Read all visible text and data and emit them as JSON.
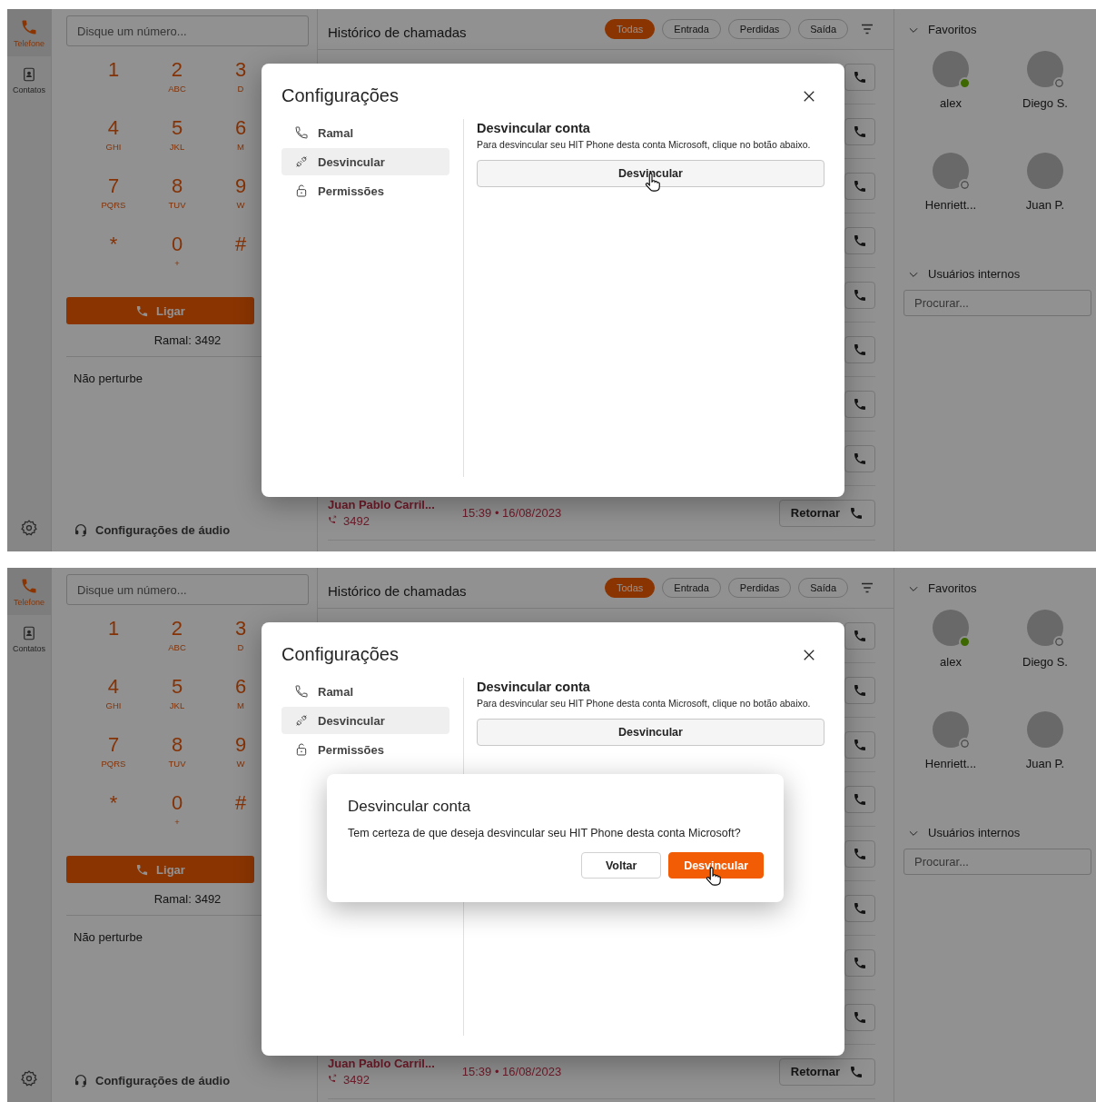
{
  "screens": [
    {
      "rail": {
        "items": [
          {
            "kind": "phone",
            "label": "Telefone",
            "selected": true
          },
          {
            "kind": "contacts",
            "label": "Contatos",
            "selected": false
          }
        ]
      },
      "dialer": {
        "search": {
          "placeholder": "Disque um número..."
        },
        "keys": [
          {
            "digit": "1"
          },
          {
            "digit": "2",
            "letters": "ABC"
          },
          {
            "digit": "3",
            "letters": "D"
          },
          {
            "digit": "4",
            "letters": "GHI"
          },
          {
            "digit": "5",
            "letters": "JKL"
          },
          {
            "digit": "6",
            "letters": "M"
          },
          {
            "digit": "7",
            "letters": "PQRS"
          },
          {
            "digit": "8",
            "letters": "TUV"
          },
          {
            "digit": "9",
            "letters": "W"
          },
          {
            "digit": "*"
          },
          {
            "digit": "0",
            "letters": "+"
          },
          {
            "digit": "#"
          }
        ],
        "call_button": "Ligar",
        "extension": "Ramal: 3492",
        "do_not_disturb": "Não perturbe",
        "audio_settings": "Configurações de áudio"
      },
      "history": {
        "title": "Histórico de chamadas",
        "filters": [
          {
            "label": "Todas",
            "selected": true
          },
          {
            "label": "Entrada",
            "selected": false
          },
          {
            "label": "Perdidas",
            "selected": false
          },
          {
            "label": "Saída",
            "selected": false
          }
        ],
        "rows": [
          {
            "kind": "covered"
          },
          {
            "kind": "covered"
          },
          {
            "kind": "covered"
          },
          {
            "kind": "covered"
          },
          {
            "kind": "covered"
          },
          {
            "kind": "covered"
          },
          {
            "kind": "covered"
          },
          {
            "kind": "covered"
          },
          {
            "kind": "call",
            "name": "Juan Pablo Carril...",
            "number": "3492",
            "time": "15:39 • 16/08/2023",
            "action": "Retornar"
          }
        ]
      },
      "contacts": {
        "favorites": {
          "title": "Favoritos",
          "expanded": true,
          "people": [
            {
              "name": "alex",
              "kind": "available"
            },
            {
              "name": "Diego S.",
              "kind": "offline"
            },
            {
              "name": "Henriett...",
              "kind": "offline"
            },
            {
              "name": "Juan P.",
              "kind": "plain"
            }
          ]
        },
        "internal": {
          "title": "Usuários internos",
          "expanded": true,
          "search": {
            "placeholder": "Procurar..."
          }
        }
      },
      "settings": {
        "title": "Configurações",
        "nav": [
          {
            "kind": "extension",
            "label": "Ramal",
            "selected": false
          },
          {
            "kind": "unlink",
            "label": "Desvincular",
            "selected": true
          },
          {
            "kind": "permissions",
            "label": "Permissões",
            "selected": false
          }
        ],
        "section": {
          "title": "Desvincular conta",
          "description": "Para desvincular seu HIT Phone desta conta Microsoft, clique no botão abaixo.",
          "button": {
            "label": "Desvincular",
            "hovered": true
          }
        }
      }
    },
    {
      "rail": {
        "items": [
          {
            "kind": "phone",
            "label": "Telefone",
            "selected": true
          },
          {
            "kind": "contacts",
            "label": "Contatos",
            "selected": false
          }
        ]
      },
      "dialer": {
        "search": {
          "placeholder": "Disque um número..."
        },
        "keys": [
          {
            "digit": "1"
          },
          {
            "digit": "2",
            "letters": "ABC"
          },
          {
            "digit": "3",
            "letters": "D"
          },
          {
            "digit": "4",
            "letters": "GHI"
          },
          {
            "digit": "5",
            "letters": "JKL"
          },
          {
            "digit": "6",
            "letters": "M"
          },
          {
            "digit": "7",
            "letters": "PQRS"
          },
          {
            "digit": "8",
            "letters": "TUV"
          },
          {
            "digit": "9",
            "letters": "W"
          },
          {
            "digit": "*"
          },
          {
            "digit": "0",
            "letters": "+"
          },
          {
            "digit": "#"
          }
        ],
        "call_button": "Ligar",
        "extension": "Ramal: 3492",
        "do_not_disturb": "Não perturbe",
        "audio_settings": "Configurações de áudio"
      },
      "history": {
        "title": "Histórico de chamadas",
        "filters": [
          {
            "label": "Todas",
            "selected": true
          },
          {
            "label": "Entrada",
            "selected": false
          },
          {
            "label": "Perdidas",
            "selected": false
          },
          {
            "label": "Saída",
            "selected": false
          }
        ],
        "rows": [
          {
            "kind": "covered"
          },
          {
            "kind": "covered"
          },
          {
            "kind": "covered"
          },
          {
            "kind": "covered"
          },
          {
            "kind": "covered"
          },
          {
            "kind": "covered"
          },
          {
            "kind": "covered"
          },
          {
            "kind": "covered"
          },
          {
            "kind": "call",
            "name": "Juan Pablo Carril...",
            "number": "3492",
            "time": "15:39 • 16/08/2023",
            "action": "Retornar"
          }
        ]
      },
      "contacts": {
        "favorites": {
          "title": "Favoritos",
          "expanded": true,
          "people": [
            {
              "name": "alex",
              "kind": "available"
            },
            {
              "name": "Diego S.",
              "kind": "offline"
            },
            {
              "name": "Henriett...",
              "kind": "offline"
            },
            {
              "name": "Juan P.",
              "kind": "plain"
            }
          ]
        },
        "internal": {
          "title": "Usuários internos",
          "expanded": true,
          "search": {
            "placeholder": "Procurar..."
          }
        }
      },
      "settings": {
        "title": "Configurações",
        "nav": [
          {
            "kind": "extension",
            "label": "Ramal",
            "selected": false
          },
          {
            "kind": "unlink",
            "label": "Desvincular",
            "selected": true
          },
          {
            "kind": "permissions",
            "label": "Permissões",
            "selected": false
          }
        ],
        "section": {
          "title": "Desvincular conta",
          "description": "Para desvincular seu HIT Phone desta conta Microsoft, clique no botão abaixo.",
          "button": {
            "label": "Desvincular",
            "hovered": false
          }
        }
      },
      "confirm": {
        "title": "Desvincular conta",
        "message": "Tem certeza de que deseja desvincular seu HIT Phone desta conta Microsoft?",
        "buttons": [
          {
            "kind": "secondary",
            "label": "Voltar",
            "hovered": false
          },
          {
            "kind": "primary",
            "label": "Desvincular",
            "hovered": true
          }
        ]
      }
    }
  ]
}
